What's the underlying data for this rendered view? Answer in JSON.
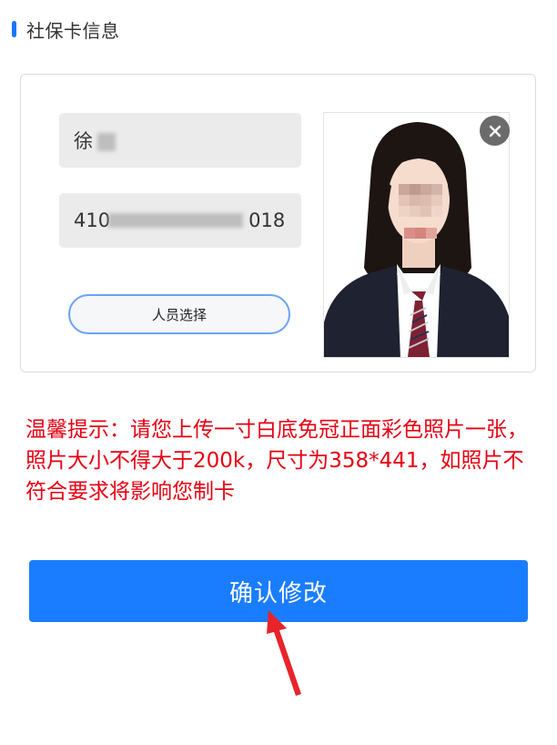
{
  "section": {
    "title": "社保卡信息"
  },
  "form": {
    "name_value": "徐",
    "id_prefix": "410",
    "id_suffix": "018",
    "person_select_label": "人员选择"
  },
  "photo": {
    "description": "id-photo"
  },
  "tip": {
    "text": "温馨提示：请您上传一寸白底免冠正面彩色照片一张，照片大小不得大于200k，尺寸为358*441，如照片不符合要求将影响您制卡"
  },
  "actions": {
    "confirm_label": "确认修改"
  },
  "colors": {
    "accent": "#1677ff",
    "warning": "#e60012",
    "annotation_arrow": "#e8232a"
  }
}
